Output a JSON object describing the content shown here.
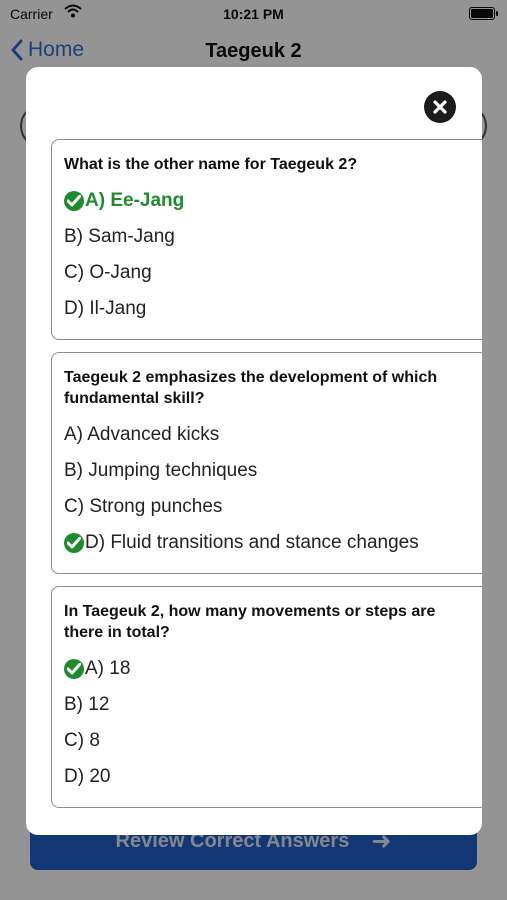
{
  "status": {
    "carrier": "Carrier",
    "time": "10:21 PM"
  },
  "nav": {
    "back_label": "Home",
    "title": "Taegeuk 2"
  },
  "background": {
    "review_label": "Review Correct Answers",
    "review_arrow": "➜"
  },
  "modal": {
    "questions": [
      {
        "question": "What is the other name for Taegeuk 2?",
        "options": [
          "A) Ee-Jang",
          "B) Sam-Jang",
          "C) O-Jang",
          "D) Il-Jang"
        ],
        "correct_index": 0,
        "correct_highlighted": true
      },
      {
        "question": "Taegeuk 2 emphasizes the development of which fundamental skill?",
        "options": [
          "A) Advanced kicks",
          "B) Jumping techniques",
          "C) Strong punches",
          "D) Fluid transitions and stance changes"
        ],
        "correct_index": 3,
        "correct_highlighted": false
      },
      {
        "question": "In Taegeuk 2, how many movements or steps are there in total?",
        "options": [
          "A) 18",
          "B) 12",
          "C) 8",
          "D) 20"
        ],
        "correct_index": 0,
        "correct_highlighted": false
      }
    ]
  },
  "colors": {
    "accent": "#2f6fd8",
    "correct": "#1e8c2e",
    "button": "#1f5fc8"
  }
}
